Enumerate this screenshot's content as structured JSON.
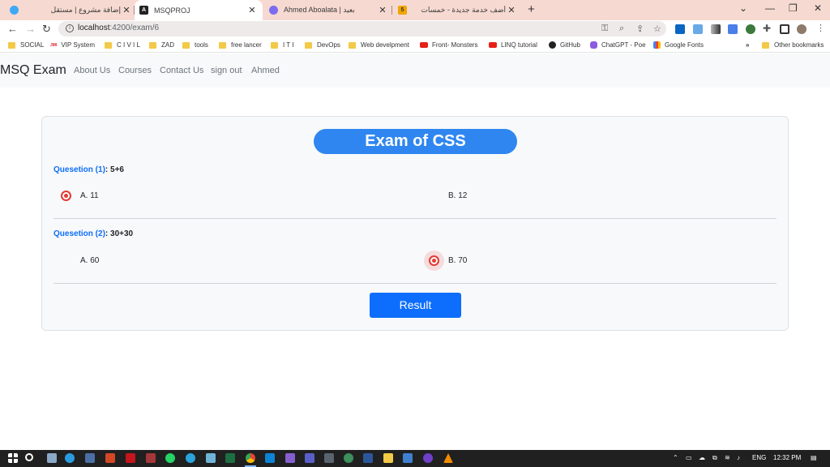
{
  "browser": {
    "tabs": [
      {
        "title": "إضافة مشروع | مستقل",
        "active": false
      },
      {
        "title": "MSQPROJ",
        "active": true
      },
      {
        "title": "Ahmed Aboalata | بعيد",
        "active": false
      },
      {
        "title": "أضف خدمة جديدة - خمسات",
        "active": false
      }
    ],
    "url_host": "localhost",
    "url_path": ":4200/exam/6",
    "bookmarks": [
      {
        "label": "SOCIAL",
        "icon": "folder"
      },
      {
        "label": "VIP System",
        "icon": "jmi"
      },
      {
        "label": "C I V I L",
        "icon": "folder"
      },
      {
        "label": "ZAD",
        "icon": "folder"
      },
      {
        "label": "tools",
        "icon": "folder"
      },
      {
        "label": "free lancer",
        "icon": "folder"
      },
      {
        "label": "I T I",
        "icon": "folder"
      },
      {
        "label": "DevOps",
        "icon": "folder"
      },
      {
        "label": "Web develpment",
        "icon": "folder"
      },
      {
        "label": "Front- Monsters",
        "icon": "youtube"
      },
      {
        "label": "LINQ tutorial",
        "icon": "youtube"
      },
      {
        "label": "GitHub",
        "icon": "github"
      },
      {
        "label": "ChatGPT - Poe",
        "icon": "poe"
      },
      {
        "label": "Google Fonts",
        "icon": "google-fonts"
      }
    ],
    "bookmarks_more": "»",
    "other_bookmarks": "Other bookmarks",
    "jmi_text": "JMI"
  },
  "app": {
    "brand": "MSQ Exam",
    "nav": [
      "About Us",
      "Courses",
      "Contact Us",
      "sign out",
      "Ahmed"
    ]
  },
  "exam": {
    "title": "Exam of CSS",
    "questions": [
      {
        "label": "Quesetion (1)",
        "text": ": 5+6",
        "options": [
          {
            "text": "A. 11",
            "selected": true
          },
          {
            "text": "B. 12",
            "selected": false
          }
        ]
      },
      {
        "label": "Quesetion (2)",
        "text": ": 30+30",
        "options": [
          {
            "text": "A. 60",
            "selected": false
          },
          {
            "text": "B. 70",
            "selected": true
          }
        ]
      }
    ],
    "result_label": "Result"
  },
  "taskbar": {
    "language": "ENG",
    "time": "12:32 PM"
  },
  "colors": {
    "primary": "#0d6efd",
    "title_pill": "#2f86f0",
    "radio_selected": "#e53935",
    "tab_strip": "#f6d9d0"
  }
}
